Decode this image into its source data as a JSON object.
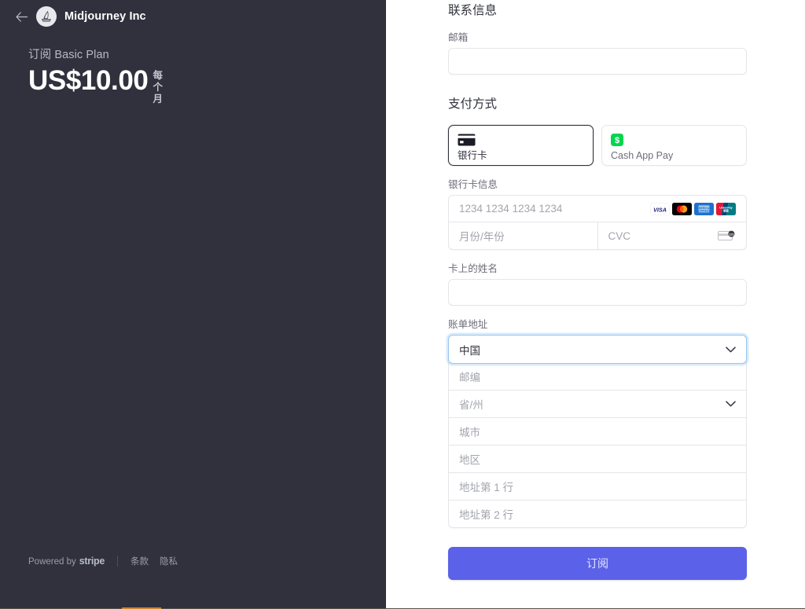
{
  "left": {
    "back_icon": "arrow-left-icon",
    "logo_icon": "midjourney-sailboat-logo",
    "merchant_name": "Midjourney Inc",
    "plan_label": "订阅 Basic Plan",
    "price_amount": "US$10.00",
    "price_interval": "每个月",
    "footer": {
      "powered_by": "Powered by",
      "stripe_word": "stripe",
      "terms": "条款",
      "privacy": "隐私"
    }
  },
  "form": {
    "contact_section_title": "联系信息",
    "email_label": "邮箱",
    "email_value": "",
    "email_placeholder": "",
    "payment_section_title": "支付方式",
    "payment_methods": [
      {
        "id": "card",
        "label": "银行卡",
        "icon": "credit-card-icon",
        "selected": true
      },
      {
        "id": "cashapp",
        "label": "Cash App Pay",
        "icon": "cash-app-icon",
        "selected": false
      }
    ],
    "card_info_label": "银行卡信息",
    "card_number_placeholder": "1234 1234 1234 1234",
    "card_expiry_placeholder": "月份/年份",
    "card_cvc_placeholder": "CVC",
    "card_brands": [
      "visa",
      "mastercard",
      "amex",
      "unionpay"
    ],
    "cvc_hint_icon": "cvc-card-icon",
    "cardholder_label": "卡上的姓名",
    "cardholder_value": "",
    "billing_section_label": "账单地址",
    "country_value": "中国",
    "country_chevron_icon": "chevron-down-icon",
    "address_fields": [
      {
        "id": "postal",
        "placeholder": "邮编",
        "type": "text"
      },
      {
        "id": "state",
        "placeholder": "省/州",
        "type": "select"
      },
      {
        "id": "city",
        "placeholder": "城市",
        "type": "text"
      },
      {
        "id": "district",
        "placeholder": "地区",
        "type": "text"
      },
      {
        "id": "line1",
        "placeholder": "地址第 1 行",
        "type": "text"
      },
      {
        "id": "line2",
        "placeholder": "地址第 2 行",
        "type": "text"
      }
    ],
    "submit_label": "订阅"
  },
  "colors": {
    "panel_bg": "#30313d",
    "accent_button": "#5b61e8",
    "focus_ring": "#96c5f0",
    "cashapp_green": "#00d64f",
    "bottom_accent": "#d08430"
  }
}
